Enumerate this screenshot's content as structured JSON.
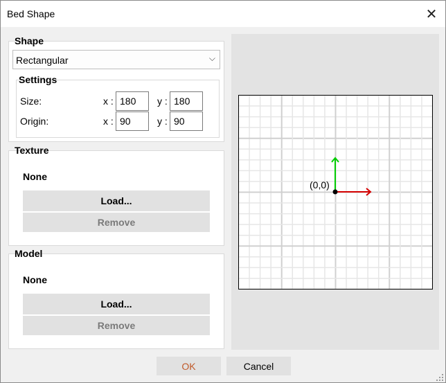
{
  "window": {
    "title": "Bed Shape"
  },
  "shape": {
    "label": "Shape",
    "selected": "Rectangular",
    "settings": {
      "label": "Settings",
      "size_label": "Size:",
      "origin_label": "Origin:",
      "x_label": "x :",
      "y_label": "y :",
      "size_x": "180",
      "size_y": "180",
      "origin_x": "90",
      "origin_y": "90"
    }
  },
  "texture": {
    "label": "Texture",
    "value": "None",
    "load": "Load...",
    "remove": "Remove"
  },
  "model": {
    "label": "Model",
    "value": "None",
    "load": "Load...",
    "remove": "Remove"
  },
  "preview": {
    "origin_text": "(0,0)",
    "x_axis_color": "#d40000",
    "y_axis_color": "#00cc00"
  },
  "buttons": {
    "ok": "OK",
    "cancel": "Cancel",
    "ok_color": "#c05a2a"
  }
}
